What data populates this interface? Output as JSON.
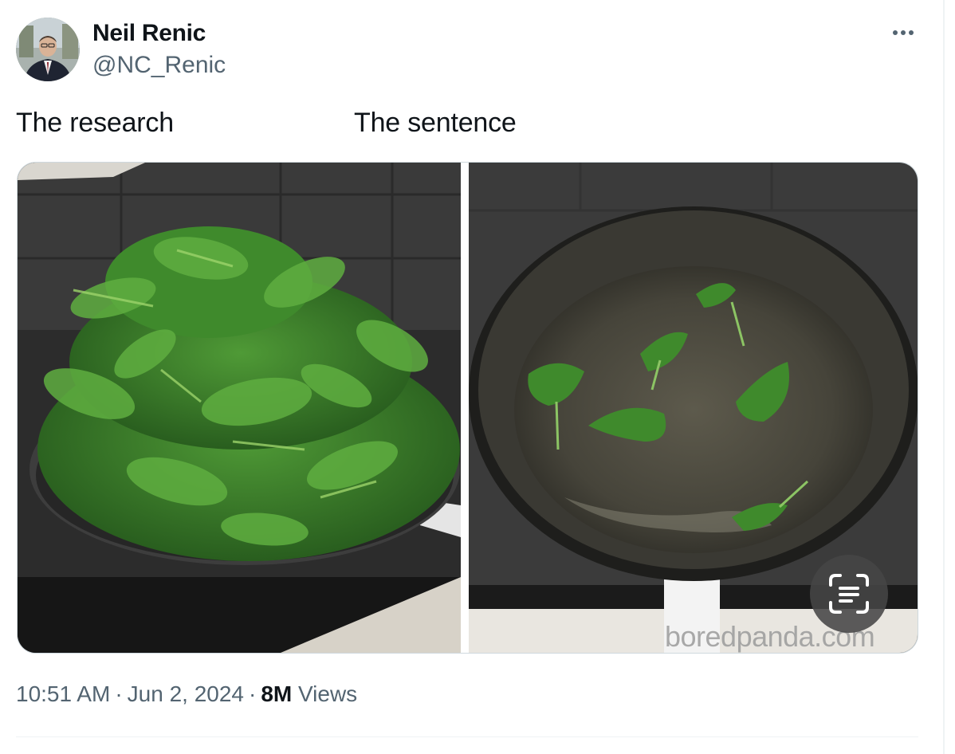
{
  "author": {
    "name": "Neil Renic",
    "handle": "@NC_Renic"
  },
  "tweet": {
    "captions": [
      "The research",
      "The sentence"
    ],
    "watermark": "boredpanda.com"
  },
  "meta": {
    "time": "10:51 AM",
    "date": "Jun 2, 2024",
    "views_count": "8M",
    "views_label": "Views"
  },
  "icons": {
    "more": "more-options-icon",
    "scan": "text-recognition-icon"
  },
  "colors": {
    "text_primary": "#0f1419",
    "text_secondary": "#536471",
    "border": "#cfd9de"
  }
}
